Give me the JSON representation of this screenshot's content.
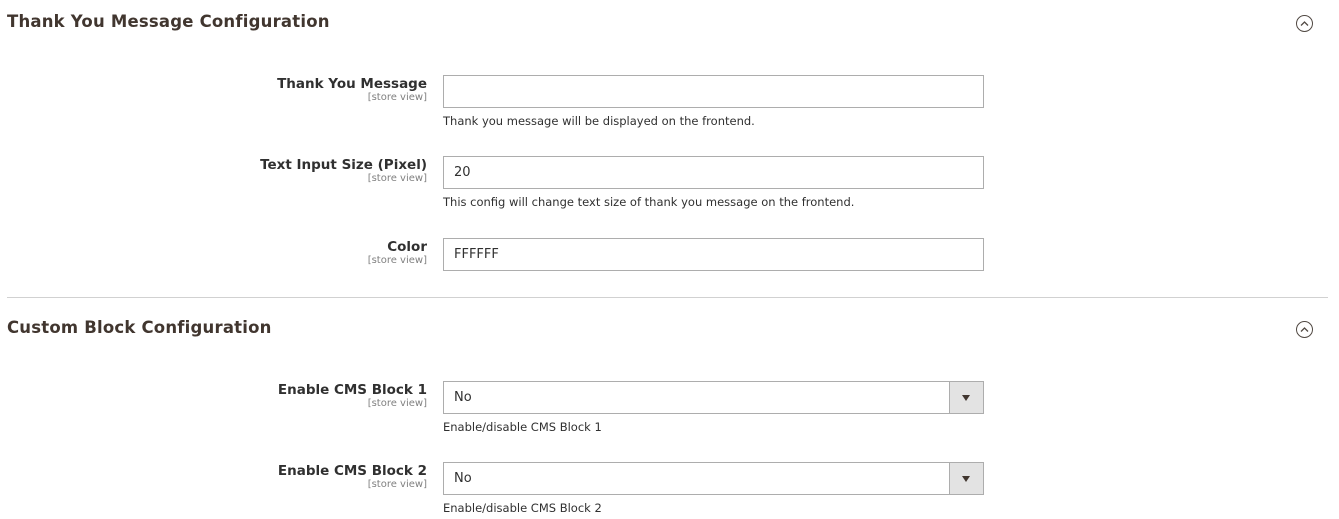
{
  "sections": [
    {
      "title": "Thank You Message Configuration",
      "toggle_icon": "collapse-up-icon",
      "fields": [
        {
          "label": "Thank You Message",
          "scope": "[store view]",
          "type": "text",
          "value": "",
          "note": "Thank you message will be displayed on the frontend."
        },
        {
          "label": "Text Input Size (Pixel)",
          "scope": "[store view]",
          "type": "text",
          "value": "20",
          "note": "This config will change text size of thank you message on the frontend."
        },
        {
          "label": "Color",
          "scope": "[store view]",
          "type": "text",
          "value": "FFFFFF",
          "note": ""
        }
      ]
    },
    {
      "title": "Custom Block Configuration",
      "toggle_icon": "collapse-up-icon",
      "fields": [
        {
          "label": "Enable CMS Block 1",
          "scope": "[store view]",
          "type": "select",
          "value": "No",
          "note": "Enable/disable CMS Block 1"
        },
        {
          "label": "Enable CMS Block 2",
          "scope": "[store view]",
          "type": "select",
          "value": "No",
          "note": "Enable/disable CMS Block 2"
        }
      ]
    }
  ],
  "colors": {
    "title": "#41362f",
    "border": "#adadad",
    "select_arrow_bg": "#e3e3e3",
    "divider": "#d1d1d1",
    "scope_text": "#808080"
  }
}
